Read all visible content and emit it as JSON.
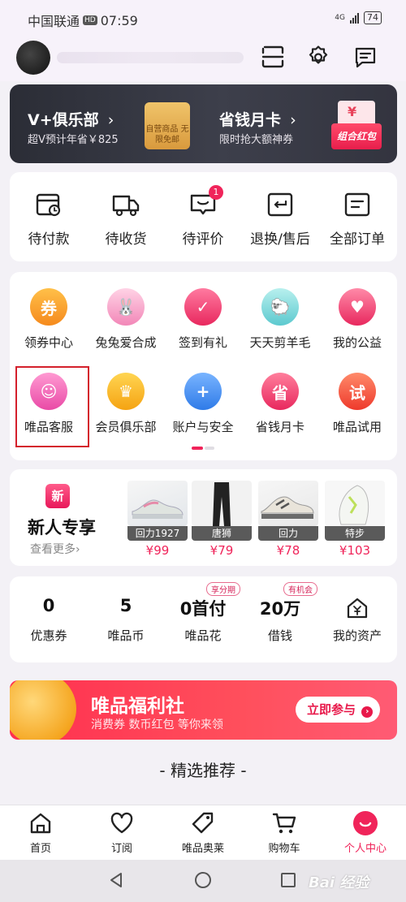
{
  "status_bar": {
    "carrier": "中国联通",
    "hd": "HD",
    "time": "07:59",
    "network": "4G",
    "battery": "74"
  },
  "header": {
    "icons": [
      "scan-icon",
      "gear-icon",
      "message-icon"
    ]
  },
  "vip": {
    "title1": "V+俱乐部",
    "sub1": "超V预计年省￥825",
    "box_text": "自营商品 无限免邮",
    "title2": "省钱月卡",
    "sub2": "限时抢大额神券",
    "redpack_text": "组合红包",
    "redpack_symbol": "¥"
  },
  "orders": {
    "items": [
      {
        "label": "待付款",
        "icon": "wallet-clock-icon"
      },
      {
        "label": "待收货",
        "icon": "truck-icon"
      },
      {
        "label": "待评价",
        "icon": "comment-icon",
        "badge": "1"
      },
      {
        "label": "退换/售后",
        "icon": "return-icon"
      },
      {
        "label": "全部订单",
        "icon": "list-icon"
      }
    ]
  },
  "services": {
    "row1": [
      {
        "label": "领券中心",
        "glyph": "券",
        "color": "#f59a2a"
      },
      {
        "label": "兔兔爱合成",
        "glyph": "🐰",
        "color": "#f2a0c8"
      },
      {
        "label": "签到有礼",
        "glyph": "✓",
        "color": "#f0457a"
      },
      {
        "label": "天天剪羊毛",
        "glyph": "🐑",
        "color": "#7fd7d9"
      },
      {
        "label": "我的公益",
        "glyph": "♥",
        "color": "#f0457a"
      }
    ],
    "row2": [
      {
        "label": "唯品客服",
        "glyph": "☺",
        "color": "#f058b0"
      },
      {
        "label": "会员俱乐部",
        "glyph": "♛",
        "color": "#f5b21a"
      },
      {
        "label": "账户与安全",
        "glyph": "+",
        "color": "#3f8ff0"
      },
      {
        "label": "省钱月卡",
        "glyph": "省",
        "color": "#f0457a"
      },
      {
        "label": "唯品试用",
        "glyph": "试",
        "color": "#f0513a"
      }
    ]
  },
  "newcomer": {
    "badge": "新",
    "title": "新人专享",
    "more": "查看更多›",
    "products": [
      {
        "brand": "回力1927",
        "price": "¥99"
      },
      {
        "brand": "唐狮",
        "price": "¥79"
      },
      {
        "brand": "回力",
        "price": "¥78"
      },
      {
        "brand": "特步",
        "price": "¥103"
      }
    ]
  },
  "assets": {
    "items": [
      {
        "value": "0",
        "label": "优惠券",
        "tag": ""
      },
      {
        "value": "5",
        "label": "唯品币",
        "tag": ""
      },
      {
        "value": "0首付",
        "label": "唯品花",
        "tag": "享分期"
      },
      {
        "value": "20万",
        "label": "借钱",
        "tag": "有机会"
      },
      {
        "value": "",
        "label": "我的资产",
        "tag": ""
      }
    ]
  },
  "banner": {
    "title": "唯品福利社",
    "subtitle": "消费券 数币红包 等你来领",
    "button": "立即参与"
  },
  "recommend": {
    "title": "- 精选推荐 -"
  },
  "tabs": [
    {
      "label": "首页",
      "icon": "home-icon"
    },
    {
      "label": "订阅",
      "icon": "heart-icon"
    },
    {
      "label": "唯品奥莱",
      "icon": "tag-icon"
    },
    {
      "label": "购物车",
      "icon": "cart-icon"
    },
    {
      "label": "个人中心",
      "icon": "profile-icon",
      "active": true
    }
  ],
  "watermark": "Bai 经验"
}
